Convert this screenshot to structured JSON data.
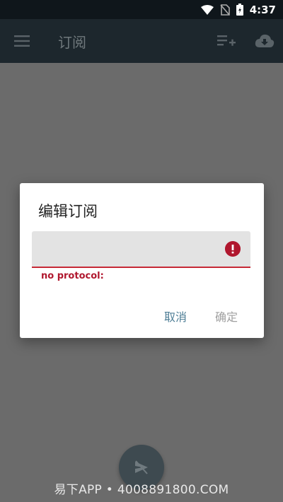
{
  "status_bar": {
    "time": "4:37"
  },
  "app_bar": {
    "title": "订阅"
  },
  "dialog": {
    "title": "编辑订阅",
    "input_value": "",
    "error_message": "no protocol:",
    "cancel_label": "取消",
    "confirm_label": "确定"
  },
  "watermark": {
    "text": "易下APP • 4008891800.COM"
  },
  "colors": {
    "status_bar": "#0f161b",
    "app_bar": "#1d272d",
    "scrim": "#6b6b6b",
    "error": "#b0172e",
    "accent_button": "#4d7d95",
    "disabled_button": "#a0a0a0"
  },
  "icons": [
    "menu-icon",
    "playlist-add-icon",
    "cloud-download-icon",
    "wifi-icon",
    "no-sim-icon",
    "battery-icon",
    "error-icon",
    "send-off-icon"
  ]
}
